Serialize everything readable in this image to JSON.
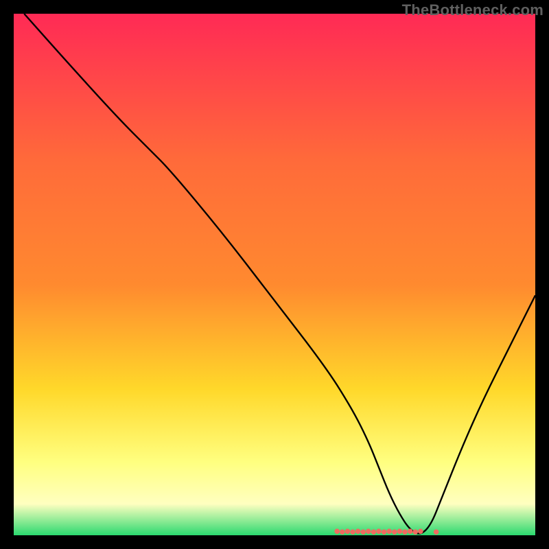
{
  "watermark": "TheBottleneck.com",
  "chart_data": {
    "type": "line",
    "title": "",
    "xlabel": "",
    "ylabel": "",
    "xlim": [
      0,
      100
    ],
    "ylim": [
      0,
      100
    ],
    "grid": false,
    "legend": false,
    "background_gradient": {
      "top": "#ff2a55",
      "mid1": "#ff8a2f",
      "mid2": "#ffd82a",
      "mid3": "#ffff80",
      "mid4": "#ffffc0",
      "bottom": "#2bd96f"
    },
    "series": [
      {
        "name": "bottleneck-curve",
        "color": "#000000",
        "x": [
          2,
          10,
          20,
          26,
          30,
          40,
          50,
          60,
          65,
          68,
          70,
          72,
          74,
          76,
          78,
          80,
          82,
          86,
          90,
          95,
          100
        ],
        "y": [
          100,
          91,
          80,
          74,
          70,
          58,
          45,
          32,
          24,
          18,
          13,
          8,
          4,
          1,
          0,
          2,
          7,
          17,
          26,
          36,
          46
        ]
      }
    ],
    "points": {
      "name": "marker-cluster",
      "color": "#ef6b60",
      "x": [
        62,
        63,
        64,
        65,
        66,
        67,
        68,
        69,
        70,
        71,
        72,
        73,
        74,
        75,
        76,
        77,
        78,
        81
      ],
      "y_fraction": 0.005
    }
  }
}
